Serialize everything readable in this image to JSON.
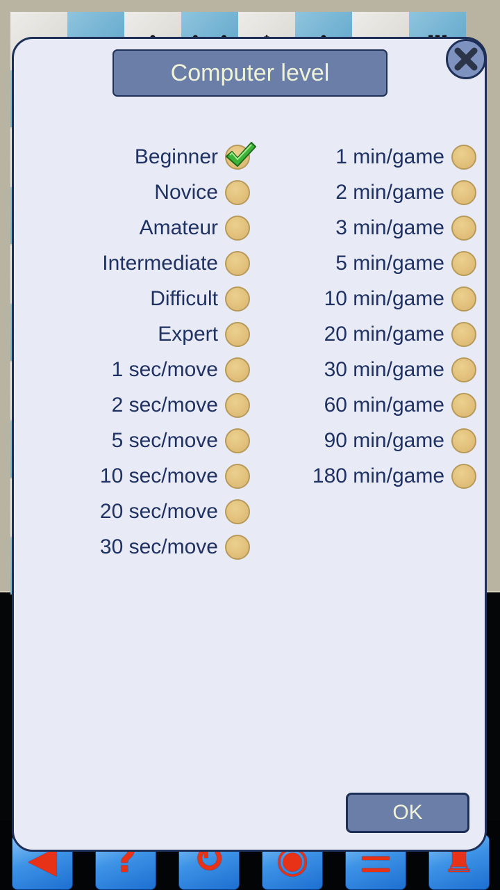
{
  "dialog": {
    "title": "Computer level",
    "close_icon": "close-x-icon",
    "ok_label": "OK",
    "selected": "Beginner",
    "left_options": [
      {
        "label": "Beginner",
        "selected": true
      },
      {
        "label": "Novice",
        "selected": false
      },
      {
        "label": "Amateur",
        "selected": false
      },
      {
        "label": "Intermediate",
        "selected": false
      },
      {
        "label": "Difficult",
        "selected": false
      },
      {
        "label": "Expert",
        "selected": false
      },
      {
        "label": "1 sec/move",
        "selected": false
      },
      {
        "label": "2 sec/move",
        "selected": false
      },
      {
        "label": "5 sec/move",
        "selected": false
      },
      {
        "label": "10 sec/move",
        "selected": false
      },
      {
        "label": "20 sec/move",
        "selected": false
      },
      {
        "label": "30 sec/move",
        "selected": false
      }
    ],
    "right_options": [
      {
        "label": "1 min/game",
        "selected": false
      },
      {
        "label": "2 min/game",
        "selected": false
      },
      {
        "label": "3 min/game",
        "selected": false
      },
      {
        "label": "5 min/game",
        "selected": false
      },
      {
        "label": "10 min/game",
        "selected": false
      },
      {
        "label": "20 min/game",
        "selected": false
      },
      {
        "label": "30 min/game",
        "selected": false
      },
      {
        "label": "60 min/game",
        "selected": false
      },
      {
        "label": "90 min/game",
        "selected": false
      },
      {
        "label": "180 min/game",
        "selected": false
      }
    ]
  },
  "board": {
    "top_row_pieces": [
      "",
      "",
      "♟",
      "♟♟",
      "♚",
      "♟",
      "",
      "♜"
    ]
  },
  "toolbar": {
    "buttons": [
      {
        "name": "back-button",
        "icon": "back-arrow-icon",
        "glyph": "◀"
      },
      {
        "name": "hint-button",
        "icon": "question-mark-icon",
        "glyph": "?"
      },
      {
        "name": "rotate-board-button",
        "icon": "rotate-arrows-icon",
        "glyph": "↻"
      },
      {
        "name": "view-button",
        "icon": "eye-icon",
        "glyph": "◉"
      },
      {
        "name": "menu-button",
        "icon": "menu-bars-icon",
        "glyph": "☰"
      },
      {
        "name": "castle-button",
        "icon": "castle-icon",
        "glyph": "♜"
      }
    ]
  },
  "colors": {
    "dialog_bg": "#e8ebf5",
    "dialog_border": "#1f3058",
    "title_bg": "#6b7ea7",
    "title_text": "#eef2d8",
    "option_text": "#1f3263",
    "radio_fill": "#e3c27f",
    "check_green": "#3cb43a"
  }
}
